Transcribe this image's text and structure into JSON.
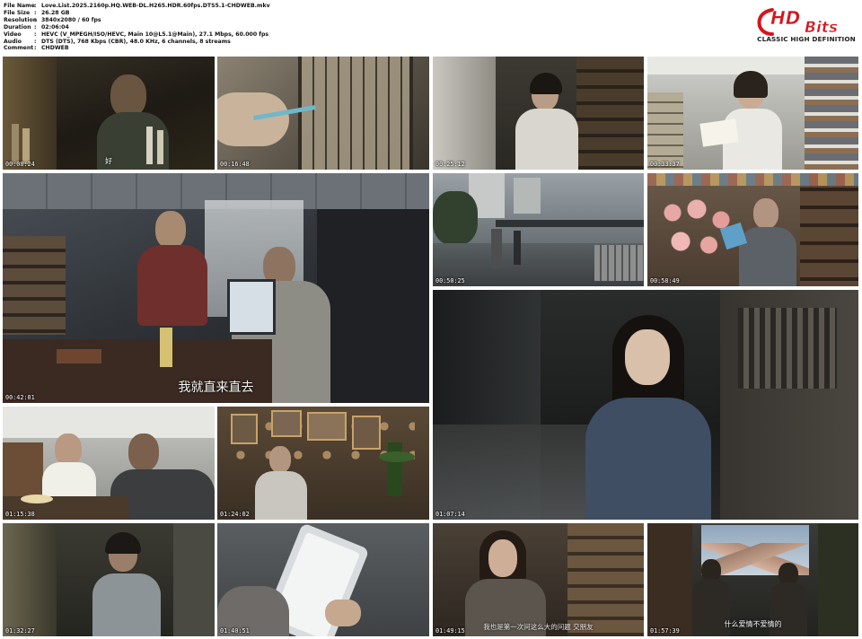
{
  "info": {
    "rows": [
      {
        "key": "File Name",
        "value": "Love.List.2025.2160p.HQ.WEB-DL.H265.HDR.60fps.DTS5.1-CHDWEB.mkv"
      },
      {
        "key": "File Size",
        "value": "26.28 GB"
      },
      {
        "key": "Resolution",
        "value": "3840x2080 / 60 fps"
      },
      {
        "key": "Duration",
        "value": "02:06:04"
      },
      {
        "key": "Video",
        "value": "HEVC (V_MPEGH/ISO/HEVC, Main 10@L5.1@Main), 27.1 Mbps, 60.000 fps"
      },
      {
        "key": "Audio",
        "value": "DTS (DTS), 768 Kbps (CBR), 48.0 KHz, 6 channels, 8 streams"
      },
      {
        "key": "Comment",
        "value": "CHDWEB"
      }
    ],
    "separator": ":"
  },
  "logo": {
    "hd": "HD",
    "bits": "Bits",
    "tagline": "CLASSIC HIGH DEFINITION",
    "color": "#d8141c"
  },
  "thumbs": [
    {
      "time": "00:08:24",
      "subtitle": "好"
    },
    {
      "time": "00:16:48",
      "subtitle": ""
    },
    {
      "time": "00:25:12",
      "subtitle": ""
    },
    {
      "time": "00:33:37",
      "subtitle": ""
    },
    {
      "time": "00:42:01",
      "subtitle": "我就直来直去"
    },
    {
      "time": "00:50:25",
      "subtitle": ""
    },
    {
      "time": "00:58:49",
      "subtitle": ""
    },
    {
      "time": "01:07:14",
      "subtitle": ""
    },
    {
      "time": "01:15:38",
      "subtitle": ""
    },
    {
      "time": "01:24:02",
      "subtitle": ""
    },
    {
      "time": "01:32:27",
      "subtitle": ""
    },
    {
      "time": "01:40:51",
      "subtitle": ""
    },
    {
      "time": "01:49:15",
      "subtitle": "我也是第一次问这么大的问题 交朋友"
    },
    {
      "time": "01:57:39",
      "subtitle": "什么爱情不爱情的"
    }
  ]
}
